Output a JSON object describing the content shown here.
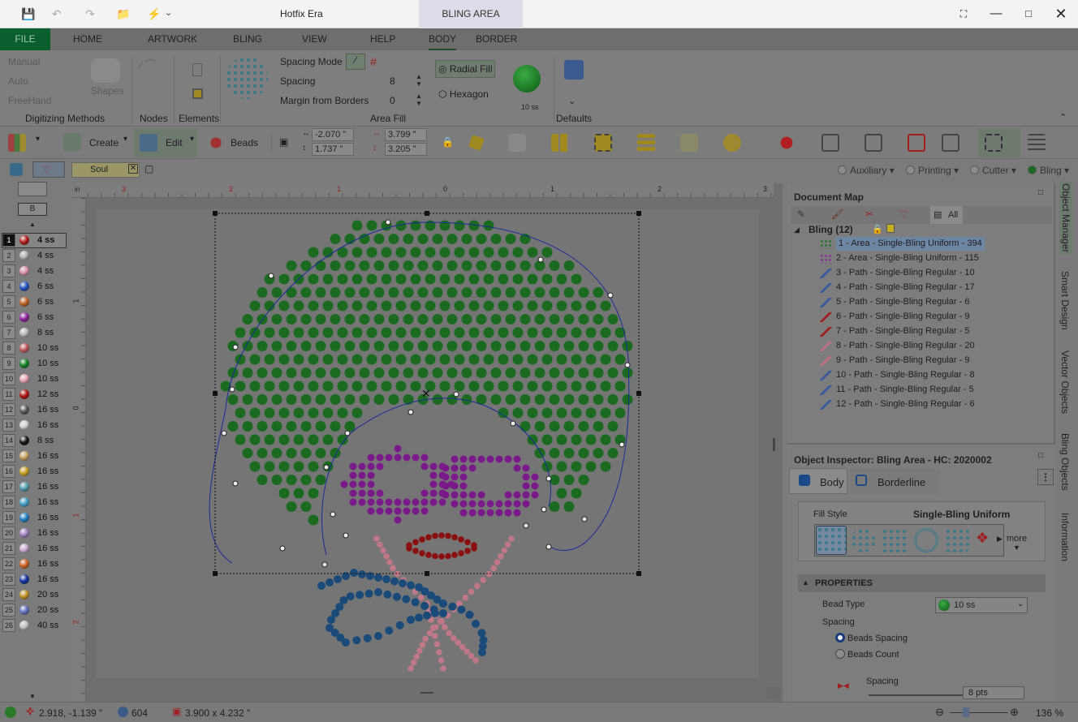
{
  "window": {
    "title": "Hotfix Era",
    "context_tab": "BLING AREA"
  },
  "ribbon_tabs": [
    "FILE",
    "HOME",
    "ARTWORK",
    "BLING",
    "VIEW",
    "HELP",
    "BODY",
    "BORDER"
  ],
  "ribbon": {
    "digitizing": {
      "manual": "Manual",
      "auto": "Auto",
      "freehand": "FreeHand",
      "shapes": "Shapes",
      "group": "Digitizing Methods"
    },
    "nodes": "Nodes",
    "elements": "Elements",
    "area_fill": {
      "spacing_mode": "Spacing Mode",
      "spacing": "Spacing",
      "spacing_value": "8",
      "margin": "Margin from Borders",
      "margin_value": "0",
      "radial_fill": "Radial Fill",
      "hexagon": "Hexagon",
      "bead_size": "10 ss",
      "group": "Area Fill"
    },
    "defaults": "Defaults"
  },
  "toolbar": {
    "create": "Create",
    "edit": "Edit",
    "beads": "Beads",
    "x": "-2.070 \"",
    "y": "1.737 \"",
    "w": "3.799 \"",
    "h": "3.205 \""
  },
  "doc_tab": "Soul",
  "output_modes": [
    "Auxiliary",
    "Printing",
    "Cutter",
    "Bling"
  ],
  "palette": {
    "header_btn": "B",
    "items": [
      {
        "n": "1",
        "size": "4 ss",
        "color": "#b01818"
      },
      {
        "n": "2",
        "size": "4 ss",
        "color": "#b0b0b0"
      },
      {
        "n": "3",
        "size": "4 ss",
        "color": "#d890a8"
      },
      {
        "n": "4",
        "size": "6 ss",
        "color": "#2050c0"
      },
      {
        "n": "5",
        "size": "6 ss",
        "color": "#c06020"
      },
      {
        "n": "6",
        "size": "6 ss",
        "color": "#9020a0"
      },
      {
        "n": "7",
        "size": "8 ss",
        "color": "#b8b8b8"
      },
      {
        "n": "8",
        "size": "10 ss",
        "color": "#c05858"
      },
      {
        "n": "9",
        "size": "10 ss",
        "color": "#108020"
      },
      {
        "n": "10",
        "size": "10 ss",
        "color": "#e8a0b0"
      },
      {
        "n": "11",
        "size": "12 ss",
        "color": "#b01010"
      },
      {
        "n": "12",
        "size": "16 ss",
        "color": "#555555"
      },
      {
        "n": "13",
        "size": "16 ss",
        "color": "#d0d0d0"
      },
      {
        "n": "14",
        "size": "8 ss",
        "color": "#111111"
      },
      {
        "n": "15",
        "size": "16 ss",
        "color": "#c8a060"
      },
      {
        "n": "16",
        "size": "16 ss",
        "color": "#c8a020"
      },
      {
        "n": "17",
        "size": "16 ss",
        "color": "#50a0b0"
      },
      {
        "n": "18",
        "size": "16 ss",
        "color": "#40a0c8"
      },
      {
        "n": "19",
        "size": "16 ss",
        "color": "#2080c0"
      },
      {
        "n": "20",
        "size": "16 ss",
        "color": "#a080c0"
      },
      {
        "n": "21",
        "size": "16 ss",
        "color": "#c8a8d0"
      },
      {
        "n": "22",
        "size": "16 ss",
        "color": "#d06020"
      },
      {
        "n": "23",
        "size": "16 ss",
        "color": "#1030a0"
      },
      {
        "n": "24",
        "size": "20 ss",
        "color": "#c09020"
      },
      {
        "n": "25",
        "size": "20 ss",
        "color": "#6070c0"
      },
      {
        "n": "26",
        "size": "40 ss",
        "color": "#c0c0c0"
      }
    ]
  },
  "ruler_top": [
    "in",
    "3",
    "2",
    "1",
    "0",
    "1",
    "2",
    "3"
  ],
  "ruler_left": [
    "1",
    "0",
    "1",
    "2"
  ],
  "document_map": {
    "title": "Document Map",
    "filter_all": "All",
    "group": "Bling (12)",
    "items": [
      {
        "label": "1 - Area - Single-Bling Uniform - 394",
        "color": "#1a7a22",
        "selected": true
      },
      {
        "label": "2 - Area - Single-Bling Uniform - 115",
        "color": "#8a2a9a"
      },
      {
        "label": "3 - Path - Single-Bling Regular - 10",
        "color": "#3a5aa0"
      },
      {
        "label": "4 - Path - Single-Bling Regular - 17",
        "color": "#3a5aa0"
      },
      {
        "label": "5 - Path - Single-Bling Regular - 6",
        "color": "#3a5aa0"
      },
      {
        "label": "6 - Path - Single-Bling Regular - 9",
        "color": "#a02020"
      },
      {
        "label": "7 - Path - Single-Bling Regular - 5",
        "color": "#a02020"
      },
      {
        "label": "8 - Path - Single-Bling Regular - 20",
        "color": "#c07080"
      },
      {
        "label": "9 - Path - Single-Bling Regular - 9",
        "color": "#c07080"
      },
      {
        "label": "10 - Path - Single-Bling Regular - 8",
        "color": "#3a5aa0"
      },
      {
        "label": "11 - Path - Single-Bling Regular - 5",
        "color": "#3a5aa0"
      },
      {
        "label": "12 - Path - Single-Bling Regular - 6",
        "color": "#3a5aa0"
      }
    ]
  },
  "inspector": {
    "title": "Object Inspector: Bling Area - HC: 2020002",
    "tab_body": "Body",
    "tab_border": "Borderline",
    "fill_style_label": "Fill Style",
    "fill_style_value": "Single-Bling Uniform",
    "more": "more",
    "properties": "PROPERTIES",
    "bead_type_label": "Bead Type",
    "bead_type_value": "10 ss",
    "spacing_label": "Spacing",
    "opt_spacing": "Beads Spacing",
    "opt_count": "Beads Count",
    "spacing_sub": "Spacing",
    "spacing_value": "8 pts"
  },
  "side_tabs": [
    "Object Manager",
    "Smart Design",
    "Vector Objects",
    "Bling Objects",
    "Information"
  ],
  "status": {
    "coords": "2.918, -1.139 \"",
    "count": "604",
    "size": "3.900 x 4.232 \"",
    "zoom": "136 %"
  }
}
